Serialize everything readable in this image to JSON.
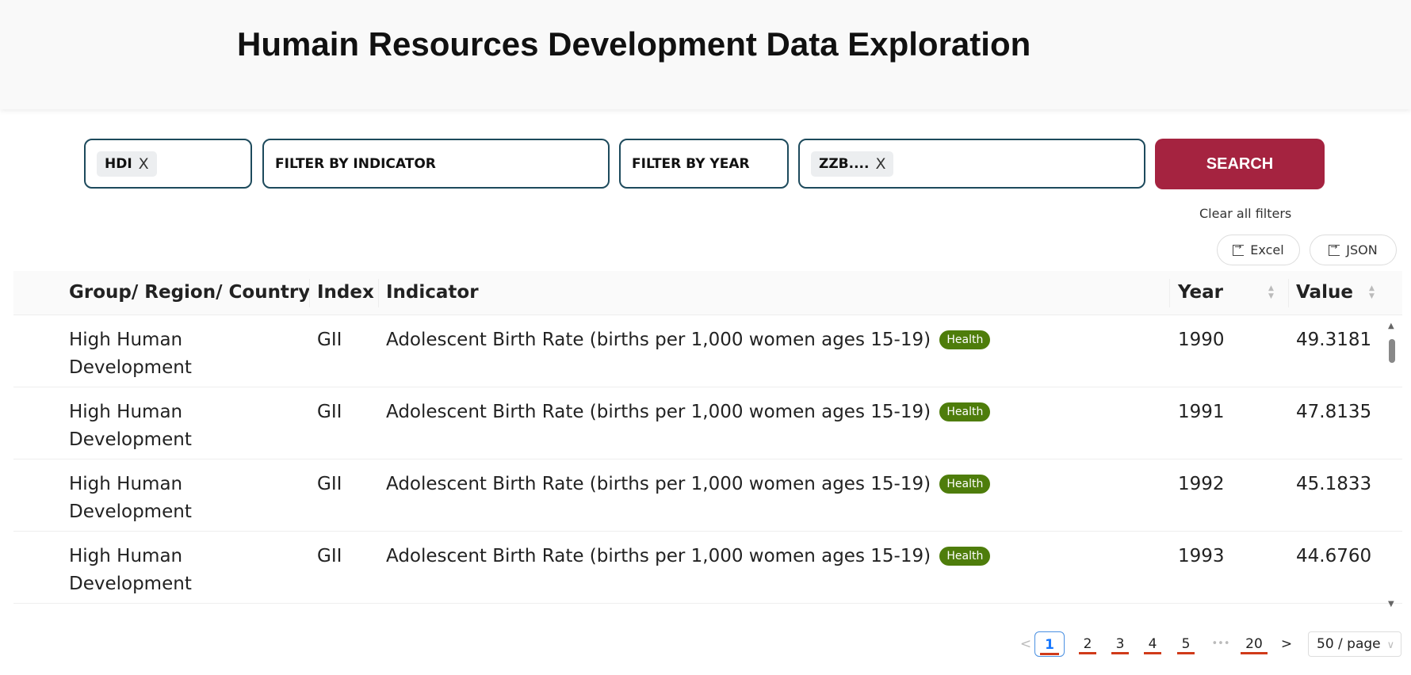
{
  "header": {
    "title": "Humain Resources Development Data Exploration"
  },
  "filters": {
    "index_tag": "HDI",
    "indicator_placeholder": "FILTER BY INDICATOR",
    "year_placeholder": "FILTER BY YEAR",
    "country_tag": "ZZB....",
    "remove": "X",
    "search_label": "SEARCH",
    "clear_label": "Clear all filters"
  },
  "export": {
    "excel": "Excel",
    "json": "JSON"
  },
  "table": {
    "columns": [
      "Group/ Region/ Country",
      "Index",
      "Indicator",
      "Year",
      "Value"
    ],
    "rows": [
      {
        "group": "High Human Development",
        "index": "GII",
        "indicator": "Adolescent Birth Rate (births per 1,000 women ages 15-19)",
        "tag": "Health",
        "year": "1990",
        "value": "49.3181"
      },
      {
        "group": "High Human Development",
        "index": "GII",
        "indicator": "Adolescent Birth Rate (births per 1,000 women ages 15-19)",
        "tag": "Health",
        "year": "1991",
        "value": "47.8135"
      },
      {
        "group": "High Human Development",
        "index": "GII",
        "indicator": "Adolescent Birth Rate (births per 1,000 women ages 15-19)",
        "tag": "Health",
        "year": "1992",
        "value": "45.1833"
      },
      {
        "group": "High Human Development",
        "index": "GII",
        "indicator": "Adolescent Birth Rate (births per 1,000 women ages 15-19)",
        "tag": "Health",
        "year": "1993",
        "value": "44.6760"
      }
    ]
  },
  "pagination": {
    "pages": [
      "1",
      "2",
      "3",
      "4",
      "5",
      "20"
    ],
    "ellipsis": "•••",
    "prev": "<",
    "next": ">",
    "page_size": "50 / page",
    "current": "1"
  },
  "colors": {
    "accent": "#a52340",
    "badge": "#4e7d0b",
    "border": "#1d4a5c"
  }
}
